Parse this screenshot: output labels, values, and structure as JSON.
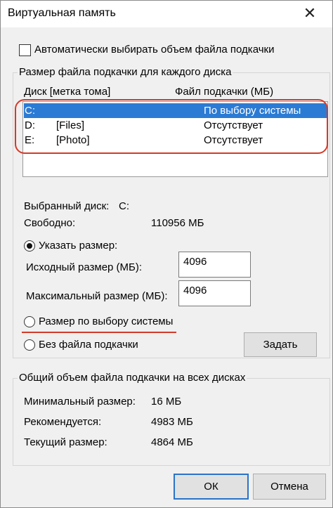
{
  "window": {
    "title": "Виртуальная память"
  },
  "auto_checkbox": {
    "label": "Автоматически выбирать объем файла подкачки",
    "checked": false
  },
  "drives_group": {
    "legend": "Размер файла подкачки для каждого диска",
    "col_drive": "Диск [метка тома]",
    "col_size": "Файл подкачки (МБ)",
    "rows": [
      {
        "drive": "C:",
        "label": "",
        "size": "По выбору системы",
        "selected": true
      },
      {
        "drive": "D:",
        "label": "[Files]",
        "size": "Отсутствует",
        "selected": false
      },
      {
        "drive": "E:",
        "label": "[Photo]",
        "size": "Отсутствует",
        "selected": false
      }
    ],
    "selected_drive_label": "Выбранный диск:",
    "selected_drive_value": "C:",
    "free_label": "Свободно:",
    "free_value": "110956 МБ",
    "custom_size_radio": "Указать размер:",
    "initial_size_label": "Исходный размер (МБ):",
    "initial_size_value": "4096",
    "max_size_label": "Максимальный размер (МБ):",
    "max_size_value": "4096",
    "system_size_radio": "Размер по выбору системы",
    "no_file_radio": "Без файла подкачки",
    "set_button": "Задать",
    "selected_option": "custom"
  },
  "totals_group": {
    "legend": "Общий объем файла подкачки на всех дисках",
    "min_label": "Минимальный размер:",
    "min_value": "16 МБ",
    "recommended_label": "Рекомендуется:",
    "recommended_value": "4983 МБ",
    "current_label": "Текущий размер:",
    "current_value": "4864 МБ"
  },
  "footer": {
    "ok": "ОК",
    "cancel": "Отмена"
  },
  "colors": {
    "selection": "#2b7bd4",
    "annotation_red": "#d23b2a",
    "default_button_border": "#2a73c9"
  }
}
